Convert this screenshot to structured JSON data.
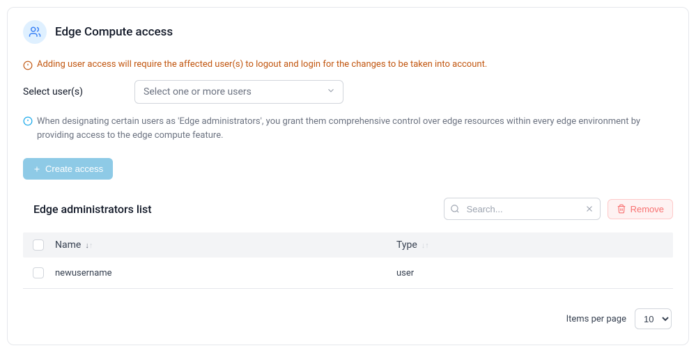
{
  "header": {
    "title": "Edge Compute access"
  },
  "warning": "Adding user access will require the affected user(s) to logout and login for the changes to be taken into account.",
  "select_label": "Select user(s)",
  "select_placeholder": "Select one or more users",
  "info": "When designating certain users as 'Edge administrators', you grant them comprehensive control over edge resources within every edge environment by providing access to the edge compute feature.",
  "create_button": "Create access",
  "list": {
    "title": "Edge administrators list",
    "search_placeholder": "Search...",
    "remove_button": "Remove",
    "columns": {
      "name": "Name",
      "type": "Type"
    },
    "rows": [
      {
        "name": "newusername",
        "type": "user"
      }
    ]
  },
  "pagination": {
    "label": "Items per page",
    "value": "10"
  }
}
